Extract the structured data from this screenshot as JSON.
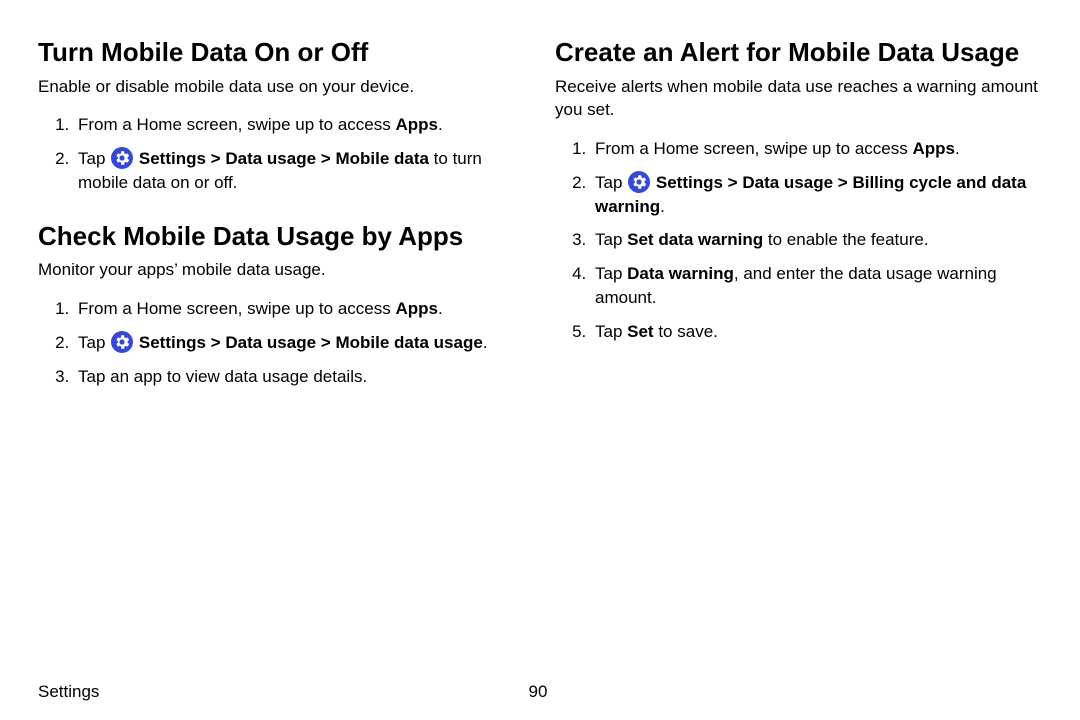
{
  "left": {
    "section1": {
      "heading": "Turn Mobile Data On or Off",
      "intro": "Enable or disable mobile data use on your device.",
      "step1_a": "From a Home screen, swipe up to access ",
      "step1_b": "Apps",
      "step1_c": ".",
      "step2_a": "Tap ",
      "step2_b": " Settings",
      "step2_c": " Data usage",
      "step2_d": " Mobile data",
      "step2_e": " to turn mobile data on or off."
    },
    "section2": {
      "heading": "Check Mobile Data Usage by Apps",
      "intro": "Monitor your apps’ mobile data usage.",
      "step1_a": "From a Home screen, swipe up to access ",
      "step1_b": "Apps",
      "step1_c": ".",
      "step2_a": "Tap ",
      "step2_b": " Settings",
      "step2_c": " Data usage",
      "step2_d": " Mobile data usage",
      "step2_e": ".",
      "step3": "Tap an app to view data usage details."
    }
  },
  "right": {
    "section1": {
      "heading": "Create an Alert for Mobile Data Usage",
      "intro": "Receive alerts when mobile data use reaches a warning amount you set.",
      "step1_a": "From a Home screen, swipe up to access ",
      "step1_b": "Apps",
      "step1_c": ".",
      "step2_a": "Tap ",
      "step2_b": " Settings",
      "step2_c": " Data usage",
      "step2_d": " Billing cycle and data warning",
      "step2_e": ".",
      "step3_a": "Tap ",
      "step3_b": "Set data warning",
      "step3_c": " to enable the feature.",
      "step4_a": "Tap ",
      "step4_b": "Data warning",
      "step4_c": ", and enter the data usage warning amount.",
      "step5_a": "Tap ",
      "step5_b": "Set",
      "step5_c": " to save."
    }
  },
  "chevron": ">",
  "footer": {
    "section": "Settings",
    "page": "90"
  }
}
